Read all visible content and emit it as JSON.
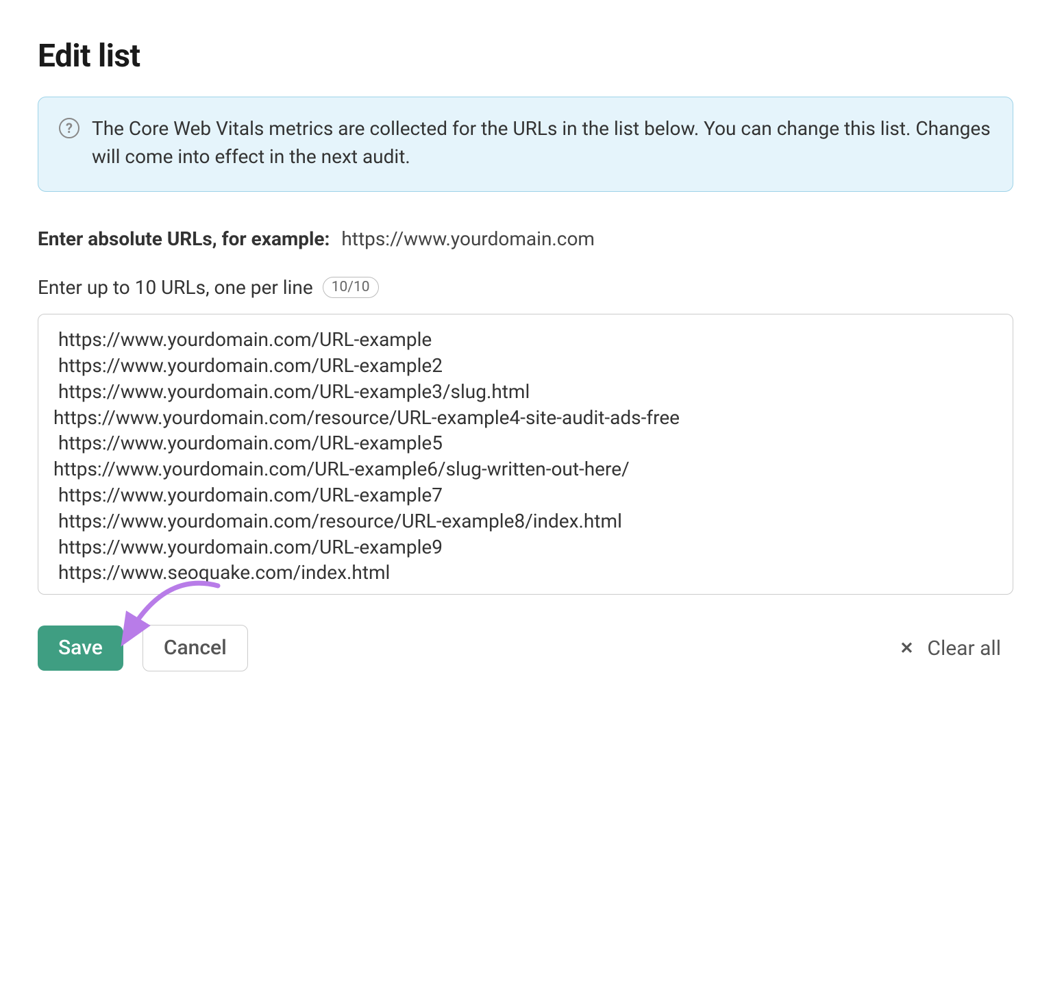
{
  "title": "Edit list",
  "banner": {
    "text": "The Core Web Vitals metrics are collected for the URLs in the list below. You can change this list. Changes will come into effect in the next audit."
  },
  "instruction": {
    "bold": "Enter absolute URLs, for example:",
    "example": "https://www.yourdomain.com"
  },
  "limit": {
    "label": "Enter up to 10 URLs, one per line",
    "count": "10/10"
  },
  "textarea": {
    "value": " https://www.yourdomain.com/URL-example\n https://www.yourdomain.com/URL-example2\n https://www.yourdomain.com/URL-example3/slug.html\nhttps://www.yourdomain.com/resource/URL-example4-site-audit-ads-free\n https://www.yourdomain.com/URL-example5\nhttps://www.yourdomain.com/URL-example6/slug-written-out-here/\n https://www.yourdomain.com/URL-example7\n https://www.yourdomain.com/resource/URL-example8/index.html\n https://www.yourdomain.com/URL-example9\n https://www.seoquake.com/index.html"
  },
  "buttons": {
    "save": "Save",
    "cancel": "Cancel",
    "clear_all": "Clear all"
  }
}
